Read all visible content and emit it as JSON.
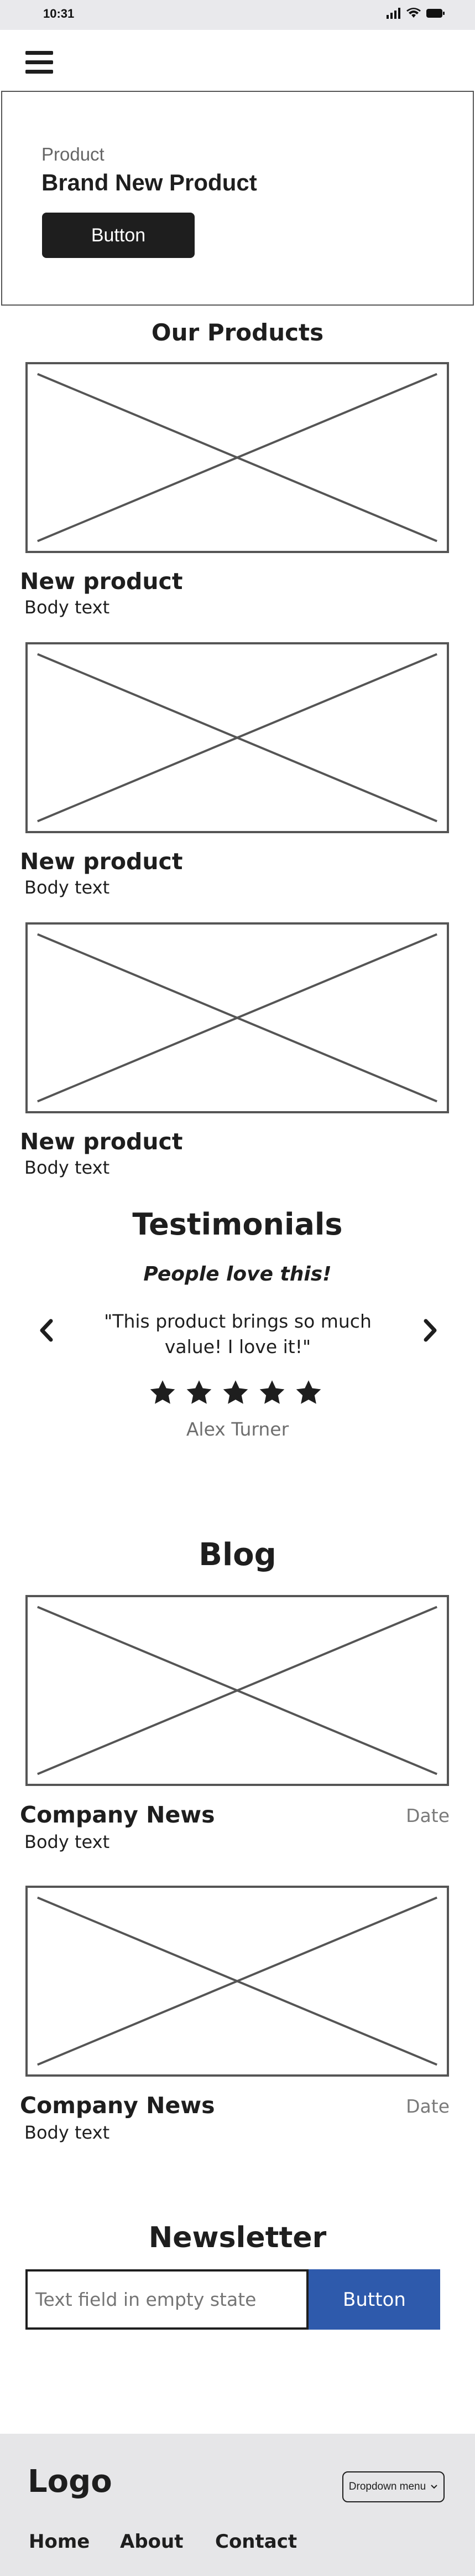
{
  "status_bar": {
    "time": "10:31"
  },
  "hero": {
    "eyebrow": "Product",
    "title": "Brand New Product",
    "button_label": "Button"
  },
  "products": {
    "title": "Our Products",
    "items": [
      {
        "title": "New product",
        "body": "Body text"
      },
      {
        "title": "New product",
        "body": "Body text"
      },
      {
        "title": "New product",
        "body": "Body text"
      }
    ]
  },
  "testimonials": {
    "title": "Testimonials",
    "subtitle": "People love this!",
    "quote": "\"This product brings so much value! I love it!\"",
    "rating": 5,
    "author": "Alex Turner"
  },
  "blog": {
    "title": "Blog",
    "posts": [
      {
        "title": "Company News",
        "date": "Date",
        "body": "Body text"
      },
      {
        "title": "Company News",
        "date": "Date",
        "body": "Body text"
      }
    ]
  },
  "newsletter": {
    "title": "Newsletter",
    "input_placeholder": "Text field in empty state",
    "button_label": "Button"
  },
  "footer": {
    "logo": "Logo",
    "dropdown_label": "Dropdown menu",
    "links": [
      "Home",
      "About",
      "Contact"
    ]
  },
  "colors": {
    "primary_button": "#2e5aac",
    "dark": "#1e1e1e",
    "footer_bg": "#e6e6e8"
  }
}
